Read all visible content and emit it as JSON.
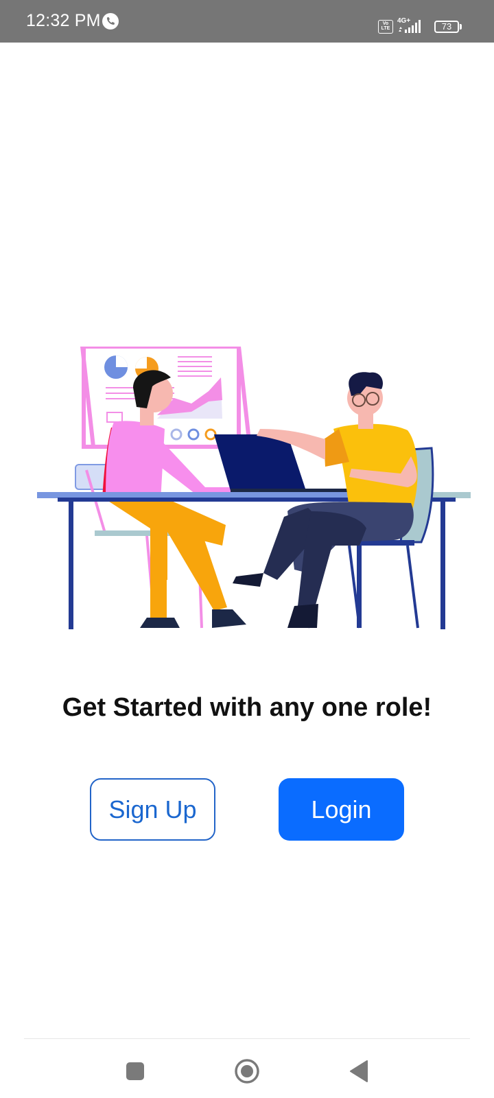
{
  "status_bar": {
    "time": "12:32 PM",
    "volte": "Vo LTE",
    "network": "4G+",
    "battery": "73"
  },
  "main": {
    "title": "Get Started with any one role!",
    "signup_label": "Sign Up",
    "login_label": "Login"
  },
  "icons": {
    "call": "phone-call-icon",
    "signal": "signal-bars-icon",
    "battery": "battery-icon",
    "recents": "square-recents-icon",
    "home": "circle-home-icon",
    "back": "triangle-back-icon"
  },
  "colors": {
    "status_bar": "#767676",
    "accent": "#0a6cff",
    "signup_border": "#2264c8"
  }
}
